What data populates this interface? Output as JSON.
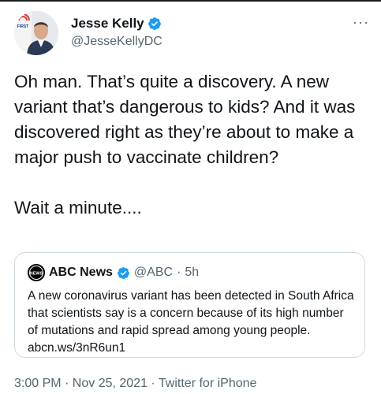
{
  "tweet": {
    "author": {
      "display_name": "Jesse Kelly",
      "handle": "@JesseKellyDC",
      "avatar_logo_text": "FIRST"
    },
    "more_label": "···",
    "text": "Oh man. That’s quite a discovery. A new variant that’s dangerous to kids? And it was discovered right as they’re about to make a major push to vaccinate children?\n\nWait a minute....",
    "quoted": {
      "avatar_text": "NEWS",
      "display_name": "ABC News",
      "handle": "@ABC",
      "separator": "·",
      "time": "5h",
      "text": "A new coronavirus variant has been detected in South Africa that scientists say is a concern because of its high number of mutations and rapid spread among young people. abcn.ws/3nR6un1"
    },
    "footer": "3:00 PM · Nov 25, 2021 · Twitter for iPhone"
  },
  "colors": {
    "verified": "#1d9bf0",
    "secondary_text": "#536471",
    "border": "#cfd9de"
  }
}
